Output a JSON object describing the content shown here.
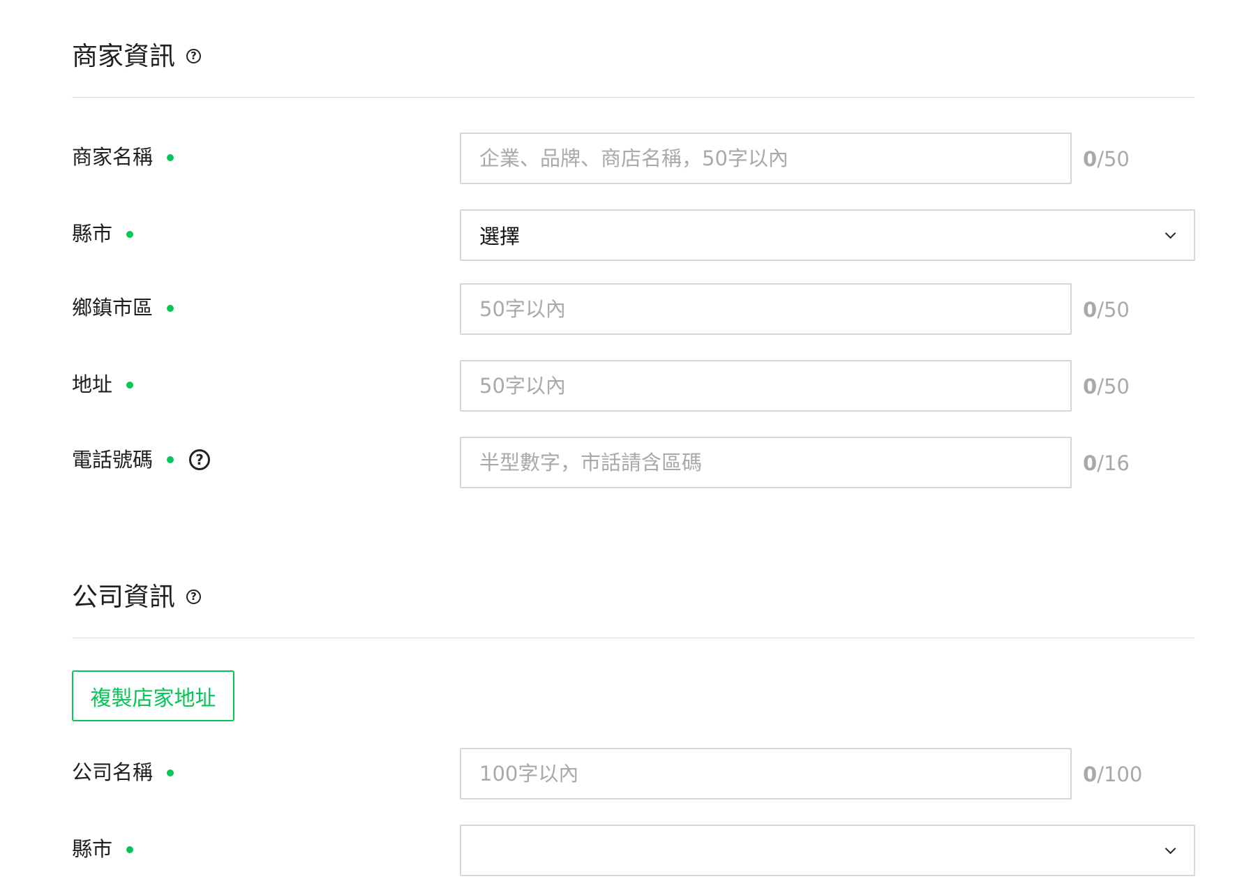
{
  "store_section": {
    "title": "商家資訊",
    "help_glyph": "?",
    "fields": {
      "name": {
        "label": "商家名稱",
        "placeholder": "企業、品牌、商店名稱，50字以內",
        "value": "",
        "count": "0",
        "max": "/50"
      },
      "city": {
        "label": "縣市",
        "selected": "選擇"
      },
      "district": {
        "label": "鄉鎮市區",
        "placeholder": "50字以內",
        "value": "",
        "count": "0",
        "max": "/50"
      },
      "address": {
        "label": "地址",
        "placeholder": "50字以內",
        "value": "",
        "count": "0",
        "max": "/50"
      },
      "phone": {
        "label": "電話號碼",
        "placeholder": "半型數字，市話請含區碼",
        "value": "",
        "count": "0",
        "max": "/16",
        "help_glyph": "?"
      }
    }
  },
  "company_section": {
    "title": "公司資訊",
    "help_glyph": "?",
    "copy_button_label": "複製店家地址",
    "fields": {
      "name": {
        "label": "公司名稱",
        "placeholder": "100字以內",
        "value": "",
        "count": "0",
        "max": "/100"
      },
      "city": {
        "label": "縣市",
        "selected": ""
      }
    }
  },
  "colors": {
    "accent_green": "#06c755",
    "placeholder_gray": "#a9a9a9",
    "border_gray": "#d6d6d6"
  }
}
